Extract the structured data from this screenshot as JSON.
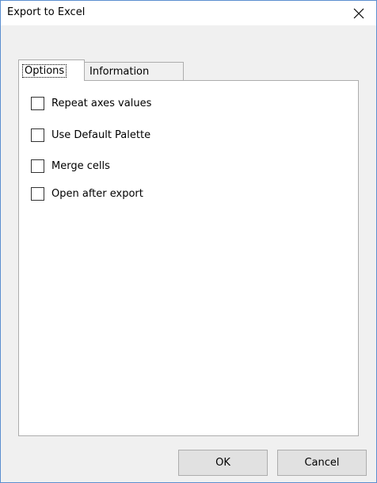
{
  "window": {
    "title": "Export to Excel"
  },
  "icons": {
    "close": "close-icon"
  },
  "tabs": [
    {
      "label": "Options",
      "selected": true
    },
    {
      "label": "Information",
      "selected": false
    }
  ],
  "options": [
    {
      "label": "Repeat axes values",
      "checked": false
    },
    {
      "label": "Use Default Palette",
      "checked": false
    },
    {
      "label": "Merge cells",
      "checked": false
    },
    {
      "label": "Open after export",
      "checked": false
    }
  ],
  "buttons": {
    "ok": "OK",
    "cancel": "Cancel"
  },
  "colors": {
    "window_border": "#5b8fcf",
    "panel_bg": "#ffffff",
    "button_bg": "#e1e1e1"
  }
}
